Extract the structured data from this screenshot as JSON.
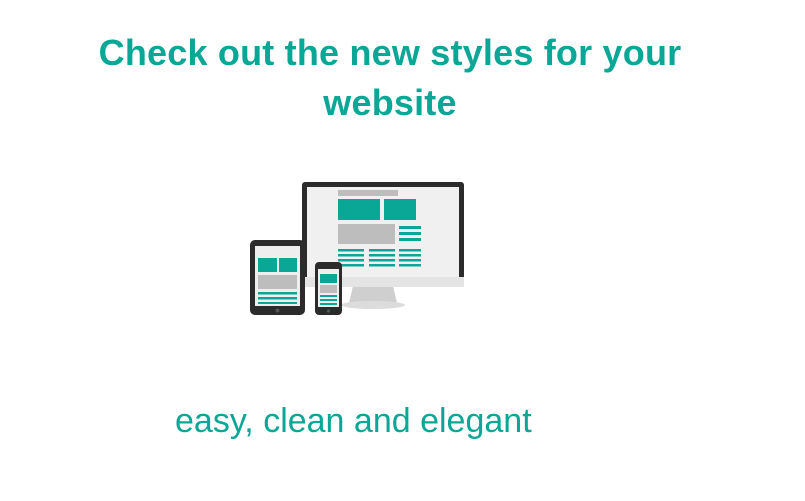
{
  "headline": {
    "text": "Check out the new styles for your website"
  },
  "tagline": {
    "text": "easy, clean and elegant"
  },
  "illustration": {
    "icon": "responsive-devices-icon"
  },
  "colors": {
    "accent": "#0aa696",
    "device_dark": "#2b2b2b",
    "screen_gray": "#bdbdbd",
    "screen_light": "#e9e9e9",
    "stand": "#d9d9d9"
  }
}
